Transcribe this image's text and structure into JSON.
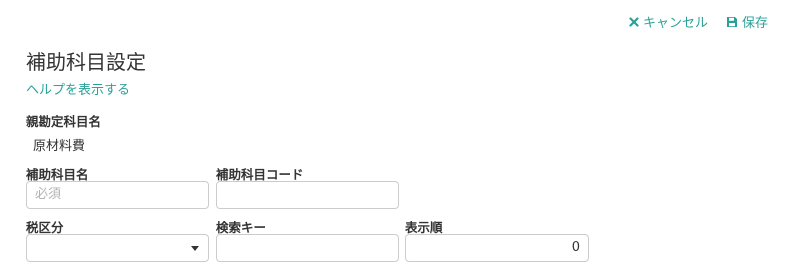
{
  "toolbar": {
    "cancel_label": "キャンセル",
    "save_label": "保存",
    "accent_color": "#2aa198"
  },
  "page": {
    "title": "補助科目設定",
    "help_link": "ヘルプを表示する"
  },
  "form": {
    "parent_label": "親勘定科目名",
    "parent_value": "原材料費",
    "name_label": "補助科目名",
    "name_placeholder": "必須",
    "name_value": "",
    "code_label": "補助科目コード",
    "code_value": "",
    "tax_label": "税区分",
    "tax_value": "",
    "search_key_label": "検索キー",
    "search_key_value": "",
    "order_label": "表示順",
    "order_value": "0"
  },
  "icons": {
    "cancel": "close-icon",
    "save": "floppy-disk-icon",
    "dropdown": "caret-down-icon"
  }
}
